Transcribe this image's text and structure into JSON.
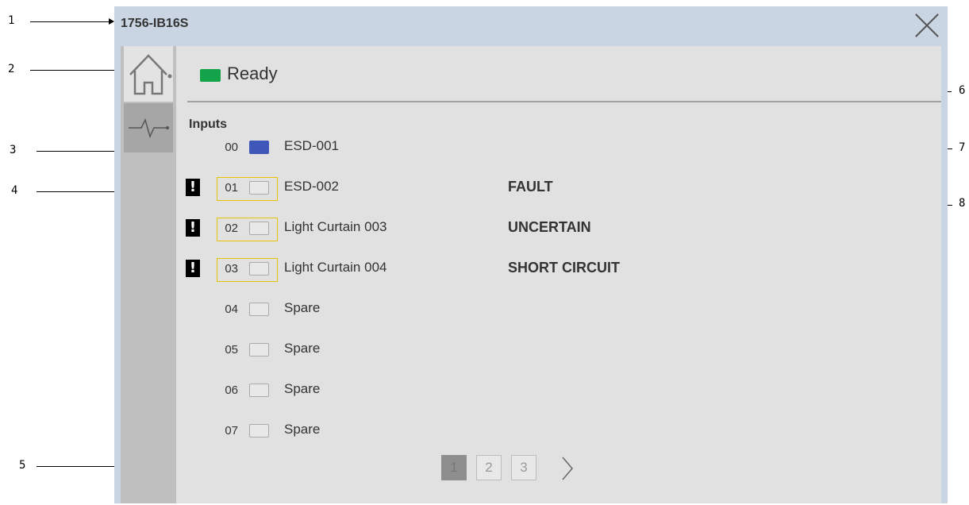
{
  "callouts": [
    "1",
    "2",
    "3",
    "4",
    "5",
    "6",
    "7",
    "8"
  ],
  "window": {
    "title": "1756-IB16S",
    "close_icon": "close-x-icon"
  },
  "sidebar": {
    "tabs": [
      {
        "icon": "home-icon"
      },
      {
        "icon": "diagnostics-pulse-icon"
      }
    ]
  },
  "status": {
    "text": "Ready",
    "led_color": "#13a34a"
  },
  "inputs": {
    "heading": "Inputs",
    "channels": [
      {
        "num": "00",
        "name": "ESD-001",
        "status": "",
        "fault": false,
        "active": true
      },
      {
        "num": "01",
        "name": "ESD-002",
        "status": "FAULT",
        "fault": true,
        "active": false
      },
      {
        "num": "02",
        "name": "Light Curtain 003",
        "status": "UNCERTAIN",
        "fault": true,
        "active": false
      },
      {
        "num": "03",
        "name": "Light Curtain 004",
        "status": "SHORT CIRCUIT",
        "fault": true,
        "active": false
      },
      {
        "num": "04",
        "name": "Spare",
        "status": "",
        "fault": false,
        "active": false
      },
      {
        "num": "05",
        "name": "Spare",
        "status": "",
        "fault": false,
        "active": false
      },
      {
        "num": "06",
        "name": "Spare",
        "status": "",
        "fault": false,
        "active": false
      },
      {
        "num": "07",
        "name": "Spare",
        "status": "",
        "fault": false,
        "active": false
      }
    ],
    "fault_icon_glyph": "!"
  },
  "pager": {
    "pages": [
      "1",
      "2",
      "3"
    ],
    "current": "1",
    "next_icon": "chevron-right-icon"
  },
  "colors": {
    "active_input": "#3f57b8",
    "fault_outline": "#e8c400",
    "window_bg": "#c9d5e3"
  }
}
